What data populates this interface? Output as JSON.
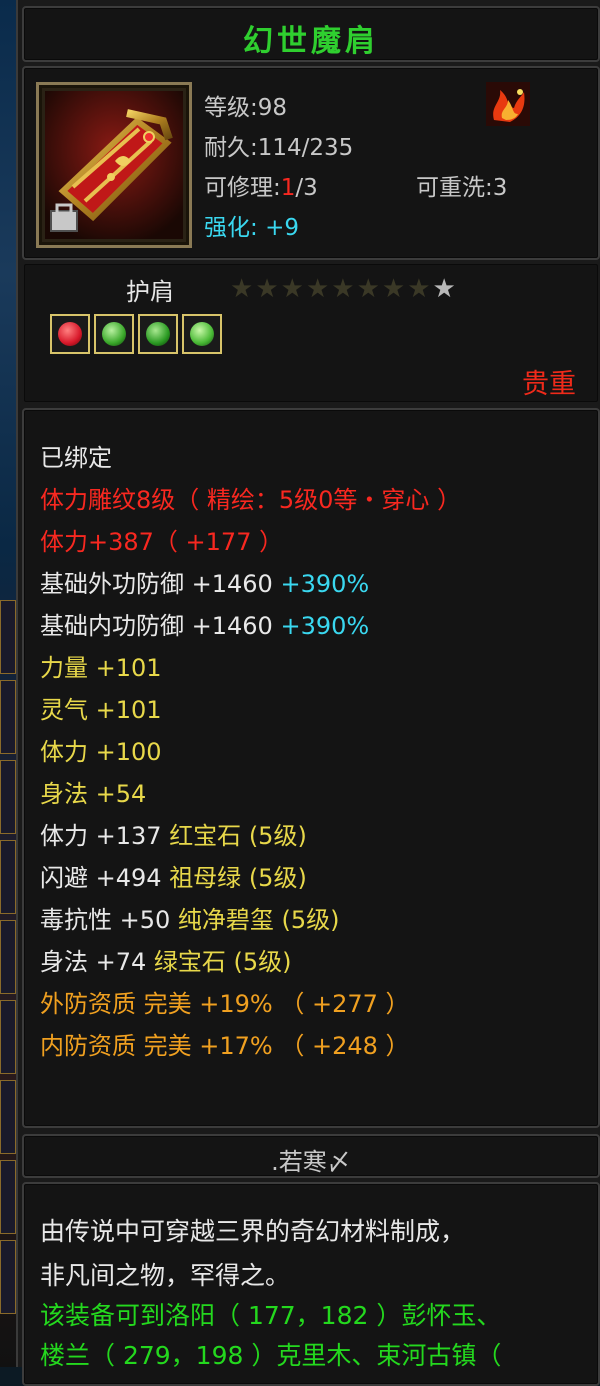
{
  "item": {
    "name": "幻世魔肩",
    "level_label": "等级",
    "level": "98",
    "durability_label": "耐久",
    "durability": "114/235",
    "repair_label": "可修理",
    "repair_current": "1",
    "repair_max": "/3",
    "rewash_label": "可重洗",
    "rewash": "3",
    "enhance_label": "强化",
    "enhance": "+9",
    "type": "护肩",
    "stars_total": 9,
    "stars_lit": 1,
    "rarity": "贵重",
    "colors": {
      "title": "#2fcf2f",
      "red": "#f82820",
      "yellow": "#e8d84a",
      "cyan": "#3ad8f0",
      "orange": "#f0a020",
      "green": "#24d81e"
    }
  },
  "gems": [
    {
      "name": "red-gem",
      "color": "#d8182a"
    },
    {
      "name": "green-gem",
      "color": "#3aa82a"
    },
    {
      "name": "green-gem",
      "color": "#2a9a22"
    },
    {
      "name": "green-gem",
      "color": "#48b834"
    }
  ],
  "stats": {
    "bound": "已绑定",
    "carving": "体力雕纹8级（ 精绘：5级0等・穿心 ）",
    "vitality_carve": "体力+387（ +177 ）",
    "outer_def_label": "基础外功防御 +1460",
    "outer_def_pct": "+390%",
    "inner_def_label": "基础内功防御 +1460",
    "inner_def_pct": "+390%",
    "strength": "力量 +101",
    "spirit": "灵气 +101",
    "vitality": "体力 +100",
    "agility": "身法 +54",
    "gem1_stat": "体力 +137",
    "gem1_name": "红宝石 (5级)",
    "gem2_stat": "闪避 +494",
    "gem2_name": "祖母绿 (5级)",
    "gem3_stat": "毒抗性 +50",
    "gem3_name": "纯净碧玺 (5级)",
    "gem4_stat": "身法 +74",
    "gem4_name": "绿宝石 (5级)",
    "outer_quality": "外防资质  完美 +19% （ +277 ）",
    "inner_quality": "内防资质  完美 +17% （ +248 ）"
  },
  "maker": ".若寒〆",
  "description": {
    "line1": "由传说中可穿越三界的奇幻材料制成，",
    "line2": "非凡间之物，罕得之。",
    "line3": "该装备可到洛阳（ 177，182 ）彭怀玉、",
    "line4": "楼兰（ 279，198 ）克里木、束河古镇（"
  }
}
